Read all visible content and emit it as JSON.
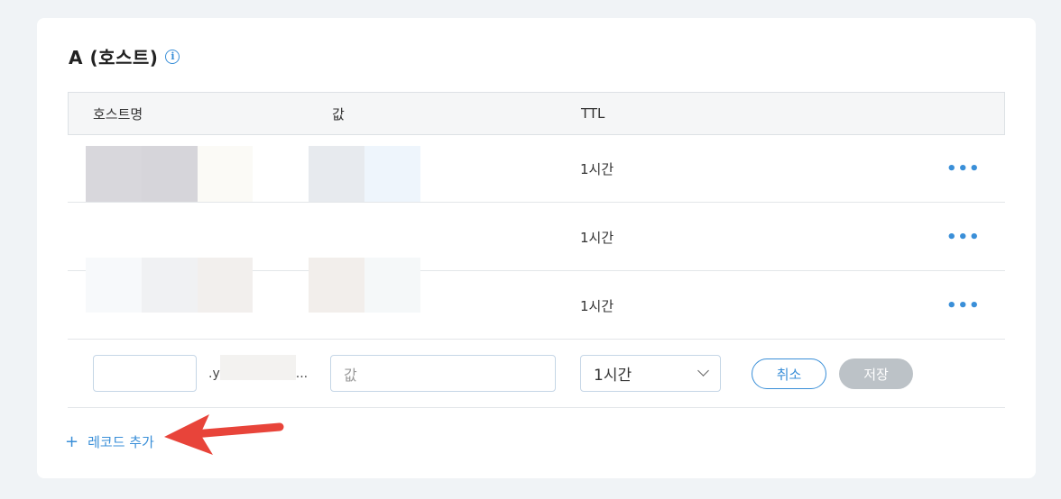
{
  "section": {
    "title": "A (호스트)",
    "info_icon": "info-icon"
  },
  "table": {
    "columns": [
      "호스트명",
      "값",
      "TTL"
    ],
    "rows": [
      {
        "ttl": "1시간",
        "more_icon": "more-icon"
      },
      {
        "ttl": "1시간",
        "more_icon": "more-icon"
      },
      {
        "ttl": "1시간",
        "more_icon": "more-icon"
      }
    ]
  },
  "edit_row": {
    "host_placeholder": "",
    "domain_suffix": ".y",
    "domain_ellipsis": "...",
    "value_placeholder": "값",
    "ttl_selected": "1시간",
    "cancel_label": "취소",
    "save_label": "저장"
  },
  "add_record": {
    "plus": "+",
    "label": "레코드 추가"
  },
  "colors": {
    "accent": "#3a8fd8",
    "annotation_arrow": "#e8443a"
  }
}
